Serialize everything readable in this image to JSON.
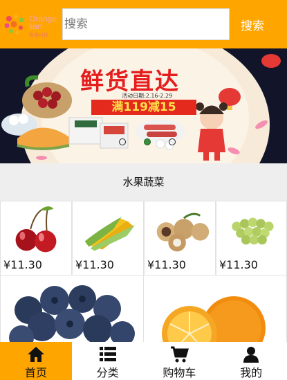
{
  "header": {
    "logo_text": "Orange",
    "logo_text2": "lian",
    "logo_cn": "橙果科技",
    "search_placeholder": "搜索",
    "search_button": "搜索"
  },
  "banner": {
    "title": "鲜货直达",
    "date": "活动日期:2.16-2.29",
    "promo": "满119减15"
  },
  "section": {
    "title": "水果蔬菜"
  },
  "products": [
    {
      "name": "cherry",
      "price": "¥11.30"
    },
    {
      "name": "corn",
      "price": "¥11.30"
    },
    {
      "name": "longan",
      "price": "¥11.30"
    },
    {
      "name": "grapes",
      "price": "¥11.30"
    }
  ],
  "featured": [
    {
      "name": "blueberry"
    },
    {
      "name": "orange"
    }
  ],
  "tabbar": {
    "tabs": [
      {
        "label": "首页",
        "icon": "home-icon",
        "active": true
      },
      {
        "label": "分类",
        "icon": "list-icon",
        "active": false
      },
      {
        "label": "购物车",
        "icon": "cart-icon",
        "active": false
      },
      {
        "label": "我的",
        "icon": "user-icon",
        "active": false
      }
    ]
  },
  "colors": {
    "accent": "#fea500",
    "promo_red": "#e42a1c"
  }
}
